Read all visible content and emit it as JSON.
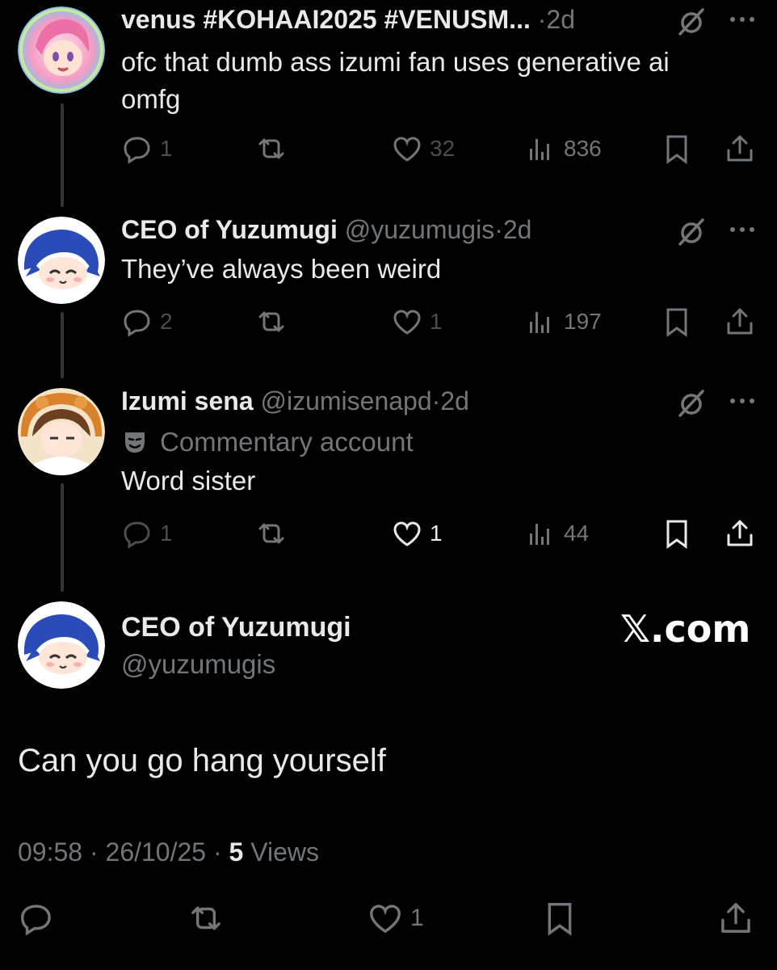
{
  "tweets": [
    {
      "name": "venus #KOHAAI2025 #VENUSM...",
      "handle": "",
      "time": "2d",
      "text": "ofc that dumb ass izumi fan uses generative ai omfg",
      "replies": "1",
      "likes": "32",
      "views": "836",
      "avatar_icon": "anime-avatar-pink-hair"
    },
    {
      "name": "CEO of Yuzumugi",
      "handle": "@yuzumugis",
      "time": "2d",
      "text": "They’ve always been weird",
      "replies": "2",
      "likes": "1",
      "views": "197",
      "avatar_icon": "anime-avatar-blue-hair"
    },
    {
      "name": "Izumi sena",
      "handle": "@izumisenapd",
      "time": "2d",
      "label": "Commentary account",
      "text": "Word sister",
      "replies": "1",
      "likes": "1",
      "views": "44",
      "avatar_icon": "anime-avatar-orange-hood"
    }
  ],
  "main_tweet": {
    "name": "CEO of Yuzumugi",
    "handle": "@yuzumugis",
    "brand": "𝕏.com",
    "text": "Can you go hang yourself",
    "time": "09:58",
    "date": "26/10/25",
    "views_count": "5",
    "views_label": "Views",
    "likes": "1"
  },
  "separator": "·",
  "colors": {
    "background": "#000000",
    "text": "#e7e9ea",
    "secondary": "#71767b",
    "thread_line": "#333639"
  }
}
